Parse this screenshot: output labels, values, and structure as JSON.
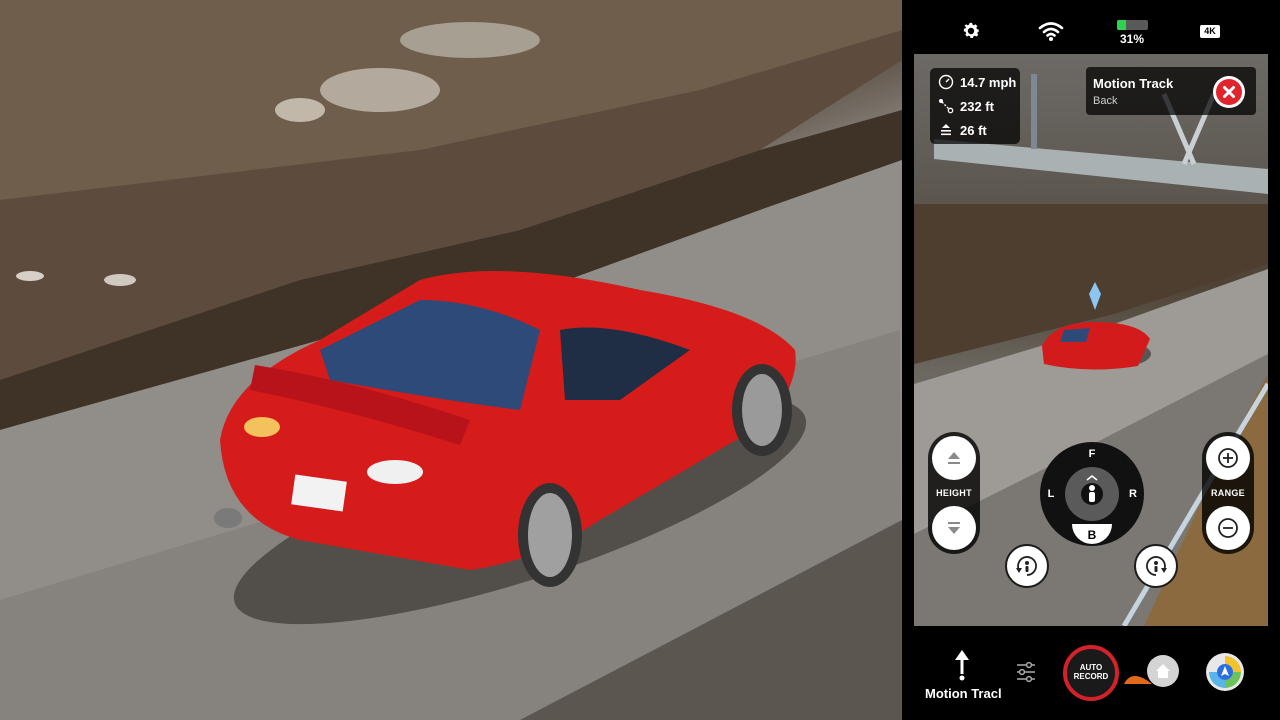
{
  "status": {
    "settings_icon": "gear-icon",
    "wifi_icon": "wifi-icon",
    "battery_percent": "31%",
    "battery_level": 0.31,
    "battery_color": "#2dd24e",
    "resolution_badge": "4K"
  },
  "telemetry": {
    "speed": "14.7 mph",
    "distance": "232 ft",
    "altitude": "26 ft"
  },
  "track_card": {
    "title": "Motion Track",
    "subtitle": "Back",
    "close_color": "#e0242b"
  },
  "controls": {
    "height_label": "HEIGHT",
    "range_label": "RANGE",
    "dpad": {
      "front": "F",
      "left": "L",
      "right": "R",
      "back": "B"
    }
  },
  "bottom": {
    "mode_label": "Motion Tracl",
    "record_label_line1": "AUTO",
    "record_label_line2": "RECORD",
    "record_color": "#d4212a"
  }
}
